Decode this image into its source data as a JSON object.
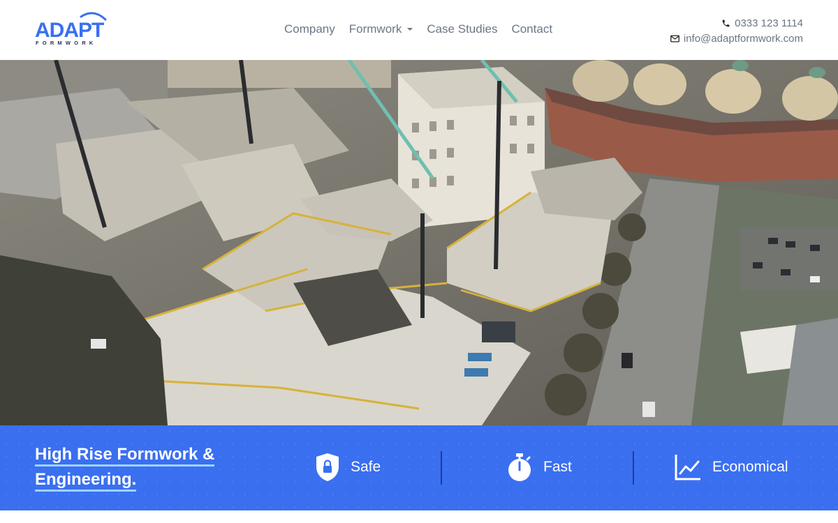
{
  "brand": {
    "name": "ADAPT",
    "sub": "FORMWORK",
    "color": "#3a6ff0"
  },
  "nav": {
    "items": [
      {
        "label": "Company"
      },
      {
        "label": "Formwork",
        "has_dropdown": true
      },
      {
        "label": "Case Studies"
      },
      {
        "label": "Contact"
      }
    ]
  },
  "contact": {
    "phone": "0333 123 1114",
    "email": "info@adaptformwork.com",
    "phone_icon": "phone-icon",
    "email_icon": "envelope-icon"
  },
  "hero": {
    "image_subject": "aerial-construction-site"
  },
  "band": {
    "tagline_line1": "High Rise Formwork &",
    "tagline_line2": "Engineering.",
    "accent_color": "#3a6ff0",
    "features": [
      {
        "label": "Safe",
        "icon": "shield-lock-icon"
      },
      {
        "label": "Fast",
        "icon": "stopwatch-icon"
      },
      {
        "label": "Economical",
        "icon": "line-chart-icon"
      }
    ]
  }
}
